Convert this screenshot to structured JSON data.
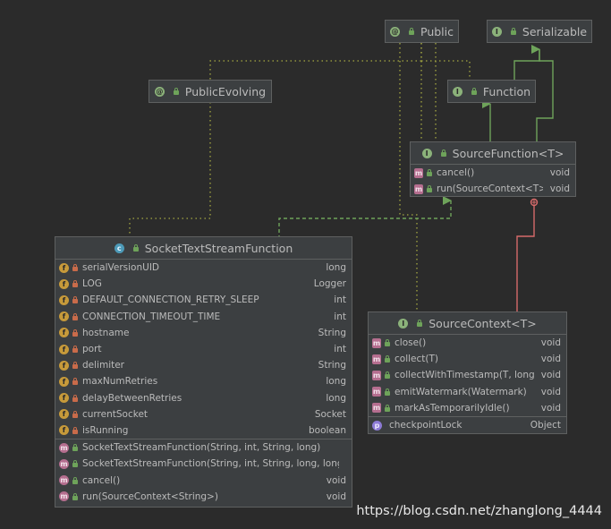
{
  "nodes": {
    "public": {
      "title": "Public",
      "kind": "annotation"
    },
    "serializable": {
      "title": "Serializable",
      "kind": "interface"
    },
    "public_evolving": {
      "title": "PublicEvolving",
      "kind": "annotation"
    },
    "function": {
      "title": "Function",
      "kind": "interface"
    },
    "source_function": {
      "title": "SourceFunction<T>",
      "kind": "interface",
      "methods": [
        {
          "name": "cancel()",
          "type": "void"
        },
        {
          "name": "run(SourceContext<T>)",
          "type": "void"
        }
      ]
    },
    "socket_fn": {
      "title": "SocketTextStreamFunction",
      "kind": "class",
      "fields": [
        {
          "name": "serialVersionUID",
          "type": "long",
          "icon": "static-final-field-icon"
        },
        {
          "name": "LOG",
          "type": "Logger",
          "icon": "static-final-field-icon"
        },
        {
          "name": "DEFAULT_CONNECTION_RETRY_SLEEP",
          "type": "int",
          "icon": "static-final-field-icon"
        },
        {
          "name": "CONNECTION_TIMEOUT_TIME",
          "type": "int",
          "icon": "static-final-field-icon"
        },
        {
          "name": "hostname",
          "type": "String",
          "icon": "final-field-icon"
        },
        {
          "name": "port",
          "type": "int",
          "icon": "final-field-icon"
        },
        {
          "name": "delimiter",
          "type": "String",
          "icon": "final-field-icon"
        },
        {
          "name": "maxNumRetries",
          "type": "long",
          "icon": "final-field-icon"
        },
        {
          "name": "delayBetweenRetries",
          "type": "long",
          "icon": "final-field-icon"
        },
        {
          "name": "currentSocket",
          "type": "Socket",
          "icon": "field-icon"
        },
        {
          "name": "isRunning",
          "type": "boolean",
          "icon": "field-icon"
        }
      ],
      "methods": [
        {
          "name": "SocketTextStreamFunction(String, int, String, long)",
          "type": ""
        },
        {
          "name": "SocketTextStreamFunction(String, int, String, long, long)",
          "type": ""
        },
        {
          "name": "cancel()",
          "type": "void"
        },
        {
          "name": "run(SourceContext<String>)",
          "type": "void"
        }
      ]
    },
    "source_context": {
      "title": "SourceContext<T>",
      "kind": "interface",
      "methods": [
        {
          "name": "close()",
          "type": "void"
        },
        {
          "name": "collect(T)",
          "type": "void"
        },
        {
          "name": "collectWithTimestamp(T, long)",
          "type": "void"
        },
        {
          "name": "emitWatermark(Watermark)",
          "type": "void"
        },
        {
          "name": "markAsTemporarilyIdle()",
          "type": "void"
        }
      ],
      "properties": [
        {
          "name": "checkpointLock",
          "type": "Object"
        }
      ]
    }
  },
  "watermark": "https://blog.csdn.net/zhanglong_4444",
  "colors": {
    "background": "#2b2b2b",
    "node_bg": "#3c3f41",
    "border": "#5e6060",
    "text": "#bbbbbb",
    "inheritance_edge": "#6ea35a",
    "annotation_edge": "#a5a842",
    "inner_edge": "#d66a6a"
  }
}
